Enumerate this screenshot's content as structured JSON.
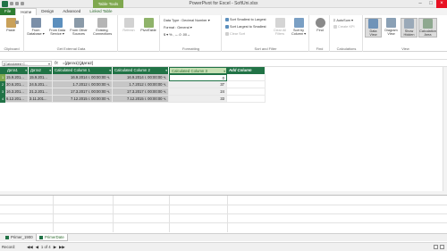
{
  "titlebar": {
    "title": "PowerPivot for Excel - SoftUni.xlsx",
    "context_tab": "Table Tools",
    "minimize": "–",
    "maximize": "□",
    "close": "×"
  },
  "tabs": [
    "File",
    "Home",
    "Design",
    "Advanced",
    "Linked Table"
  ],
  "ribbon": {
    "clipboard": {
      "paste": "Paste",
      "copy": "Copy",
      "label": "Clipboard"
    },
    "external": {
      "from_database": "From Database ▾",
      "from_data_service": "From Data Service ▾",
      "from_other_sources": "From Other Sources",
      "existing_connections": "Existing Connections",
      "label": "Get External Data"
    },
    "refresh": "Refresh",
    "pivottable": "PivotTable",
    "formatting": {
      "data_type": "Data Type : Decimal Number ▾",
      "format": "Format : General ▾",
      "symbols": "$ ▾  %  ,  ←.0  .00→",
      "label": "Formatting"
    },
    "sort": {
      "sort_asc": "Sort Smallest to Largest",
      "sort_desc": "Sort Largest to Smallest",
      "clear_sort": "Clear Sort",
      "clear_all_filters": "Clear All Filters",
      "sort_by_column": "Sort by Column ▾",
      "label": "Sort and Filter"
    },
    "find": {
      "find": "Find",
      "label": "Find"
    },
    "calculations": {
      "autosum": "AutoSum ▾",
      "create_kpi": "Create KPI",
      "label": "Calculations"
    },
    "view": {
      "data_view": "Data View",
      "diagram_view": "Diagram View",
      "show_hidden": "Show Hidden",
      "calculation_area": "Calculation Area",
      "label": "View"
    }
  },
  "formula_bar": {
    "name_box": "[Calculated C...",
    "fx": "fx",
    "formula": "=[Дата1]-[Дата2]"
  },
  "grid": {
    "columns": [
      "Дата1",
      "Дата2",
      "Calculated Column 1",
      "Calculated Column 2",
      "Calculated Column 3",
      "Add Column"
    ],
    "rows": [
      {
        "num": "1",
        "cells": [
          "15.9.201...",
          "15.9.201...",
          "16.9.2014 г. 00:00:00 ч.",
          "16.9.2014 г. 00:00:00 ч.",
          "0"
        ]
      },
      {
        "num": "2",
        "cells": [
          "30.6.201...",
          "24.5.201...",
          "1.7.2012 г. 00:00:00 ч.",
          "1.7.2012 г. 00:00:00 ч.",
          "37"
        ]
      },
      {
        "num": "3",
        "cells": [
          "16.3.201...",
          "21.2.201...",
          "17.3.2017 г. 00:00:00 ч.",
          "17.3.2017 г. 00:00:00 ч.",
          "24"
        ]
      },
      {
        "num": "4",
        "cells": [
          "6.12.201...",
          "3.11.201...",
          "7.12.2015 г. 00:00:00 ч.",
          "7.12.2015 г. 00:00:00 ч.",
          "33"
        ]
      }
    ]
  },
  "sheets": [
    "Primer_1900",
    "PrimerDate"
  ],
  "status": {
    "record": "Record:",
    "first": "◀◀",
    "prev": "◀",
    "position": "1 of 4",
    "next": "▶",
    "last": "▶▶"
  },
  "colors": {
    "accent": "#217346",
    "context": "#7fa84f",
    "selected_header": "#c6e0b4"
  }
}
